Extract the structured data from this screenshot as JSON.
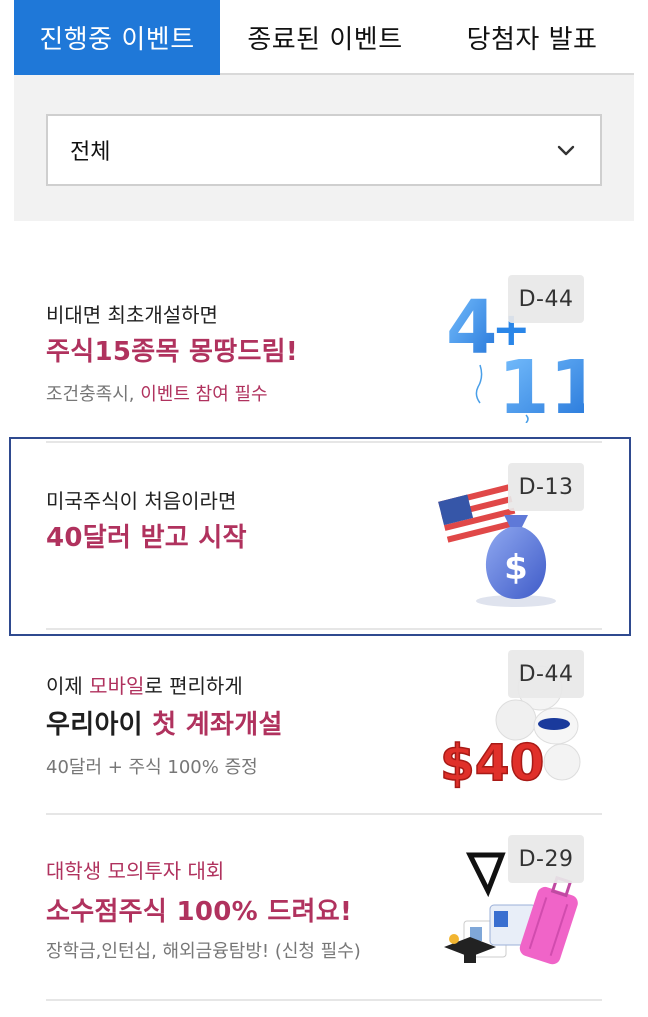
{
  "tabs": [
    {
      "label": "진행중 이벤트",
      "active": true
    },
    {
      "label": "종료된 이벤트",
      "active": false
    },
    {
      "label": "당첨자 발표",
      "active": false
    }
  ],
  "filter": {
    "selected": "전체"
  },
  "colors": {
    "accent": "#1f78d8",
    "highlight": "#b0325e",
    "focus": "#2f4a8f"
  },
  "events": [
    {
      "subtitle": "비대면 최초개설하면",
      "title": "주식15종목 몽땅드림!",
      "desc_a": "조건충족시, ",
      "desc_b": "이벤트 참여 필수",
      "dday": "D-44",
      "thumb_icon": "balloon-4-plus-11-icon"
    },
    {
      "subtitle": "미국주식이 처음이라면",
      "title": "40달러 받고 시작",
      "dday": "D-13",
      "thumb_icon": "us-flag-money-bag-icon"
    },
    {
      "subtitle_a": "이제 ",
      "subtitle_b": "모바일",
      "subtitle_c": "로 편리하게",
      "title_a": "우리아이 ",
      "title_b": "첫 계좌개설",
      "desc": "40달러 + 주식 100% 증정",
      "dday": "D-44",
      "thumb_icon": "dollar-40-brand-logos-icon"
    },
    {
      "subtitle": "대학생 모의투자 대회",
      "title": "소수점주식 100% 드려요!",
      "desc": "장학금,인턴십, 해외금융탐방! (신청 필수)",
      "dday": "D-29",
      "thumb_icon": "graduation-travel-suitcase-icon"
    }
  ]
}
